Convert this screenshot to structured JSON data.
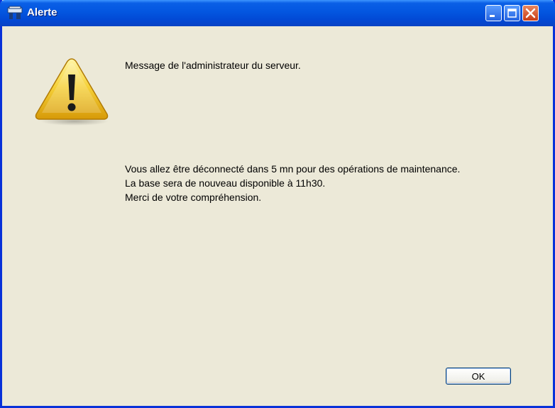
{
  "window": {
    "title": "Alerte",
    "buttons": {
      "minimize": "minimize-icon",
      "maximize": "maximize-icon",
      "close": "close-icon"
    }
  },
  "dialog": {
    "icon": "warning-icon",
    "heading": "Message de l'administrateur du serveur.",
    "body_lines": [
      "Vous allez être déconnecté dans 5 mn pour des opérations de maintenance.",
      "La base sera de nouveau disponible à 11h30.",
      "Merci de votre compréhension."
    ],
    "ok_label": "OK"
  },
  "colors": {
    "titlebar": "#0356e0",
    "dialog_background": "#ece9d8",
    "close_button": "#c93c16"
  }
}
